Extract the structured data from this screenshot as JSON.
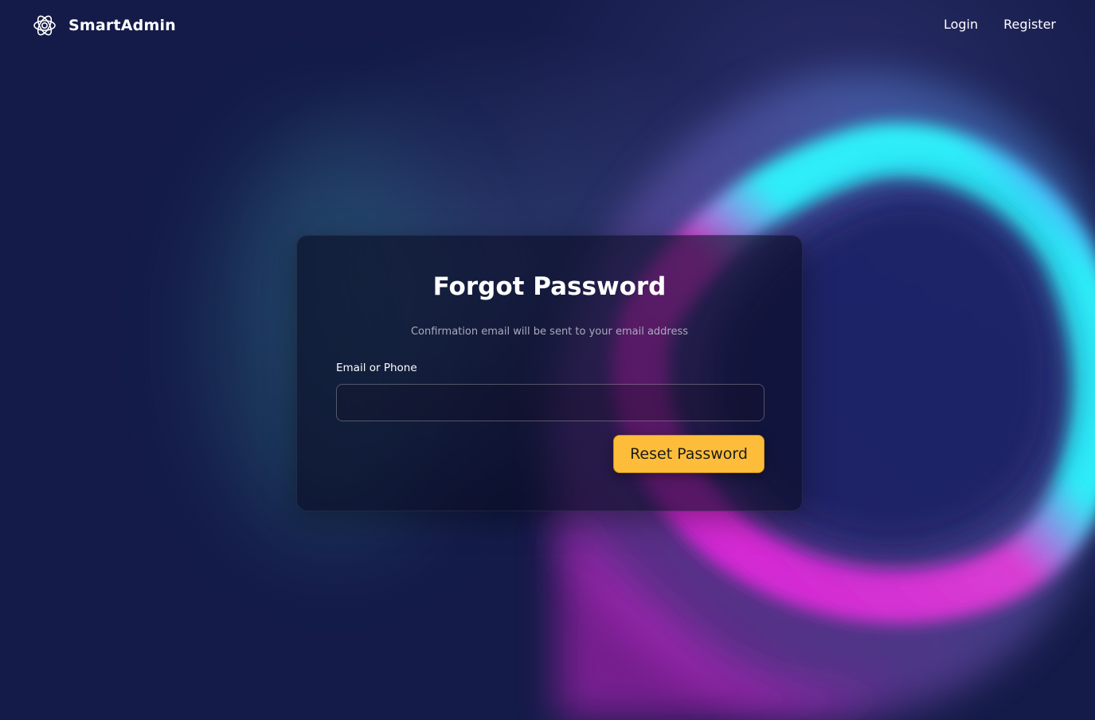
{
  "brand": {
    "name": "SmartAdmin",
    "icon": "atom-logo-icon"
  },
  "nav": {
    "login": "Login",
    "register": "Register"
  },
  "card": {
    "title": "Forgot Password",
    "subtitle": "Confirmation email will be sent to your email address",
    "field_label": "Email or Phone",
    "field_value": "",
    "field_placeholder": "",
    "submit_label": "Reset Password"
  },
  "colors": {
    "background": "#141b48",
    "accent_button": "#fdbd3b",
    "glow_cyan": "#2ef6ff",
    "glow_magenta": "#d61ed8"
  }
}
